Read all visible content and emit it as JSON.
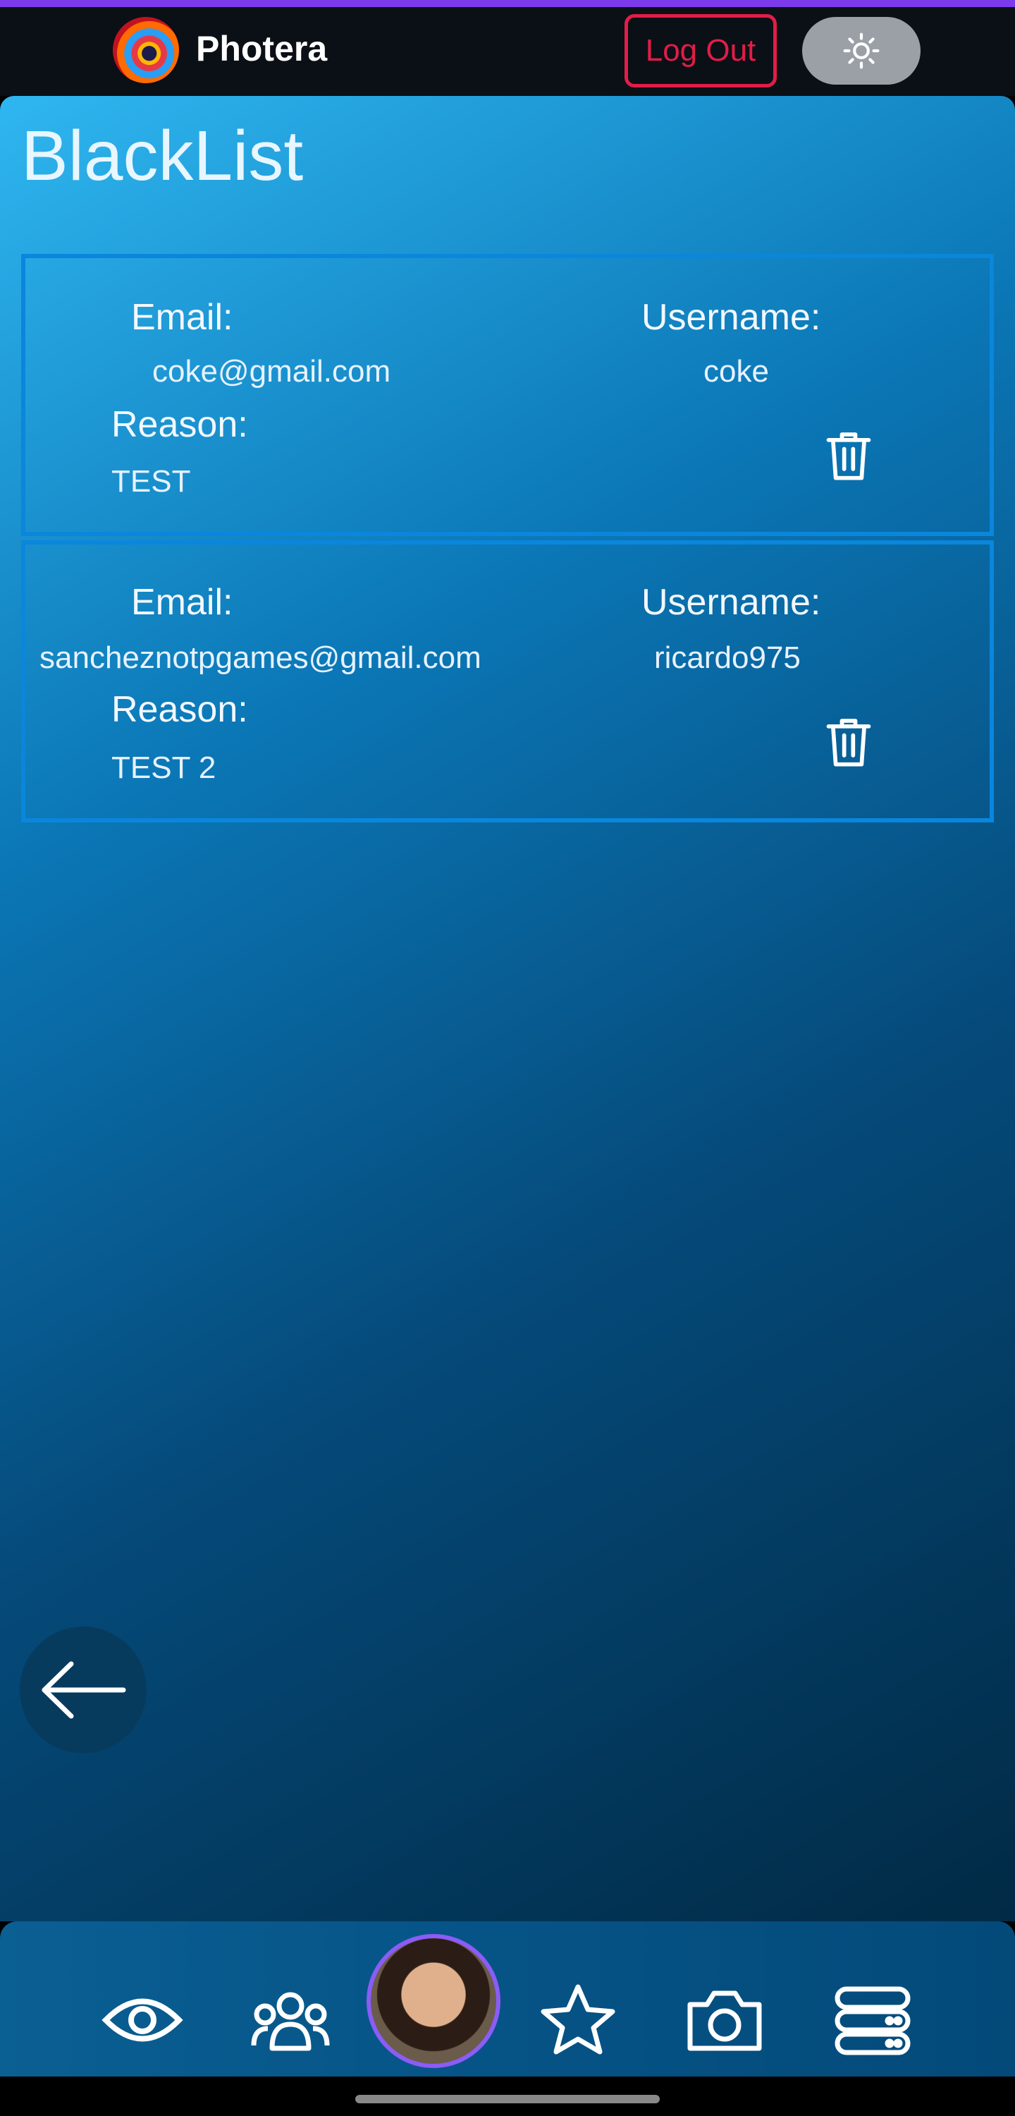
{
  "app": {
    "name": "Photera"
  },
  "header": {
    "logout_label": "Log Out"
  },
  "page": {
    "title": "BlackList"
  },
  "labels": {
    "email": "Email:",
    "username": "Username:",
    "reason": "Reason:"
  },
  "entries": [
    {
      "email": "coke@gmail.com",
      "username": "coke",
      "reason": "TEST"
    },
    {
      "email": "sancheznotpgames@gmail.com",
      "username": "ricardo975",
      "reason": "TEST 2"
    }
  ],
  "icons": {
    "theme": "sun-icon",
    "delete": "trash-icon",
    "back": "arrow-left-icon",
    "nav": [
      "eye-icon",
      "users-icon",
      "avatar",
      "star-icon",
      "camera-icon",
      "server-icon"
    ]
  },
  "colors": {
    "accent_stripe": "#7c3aed",
    "logout": "#e11d48",
    "card_border": "#0a86dd"
  }
}
